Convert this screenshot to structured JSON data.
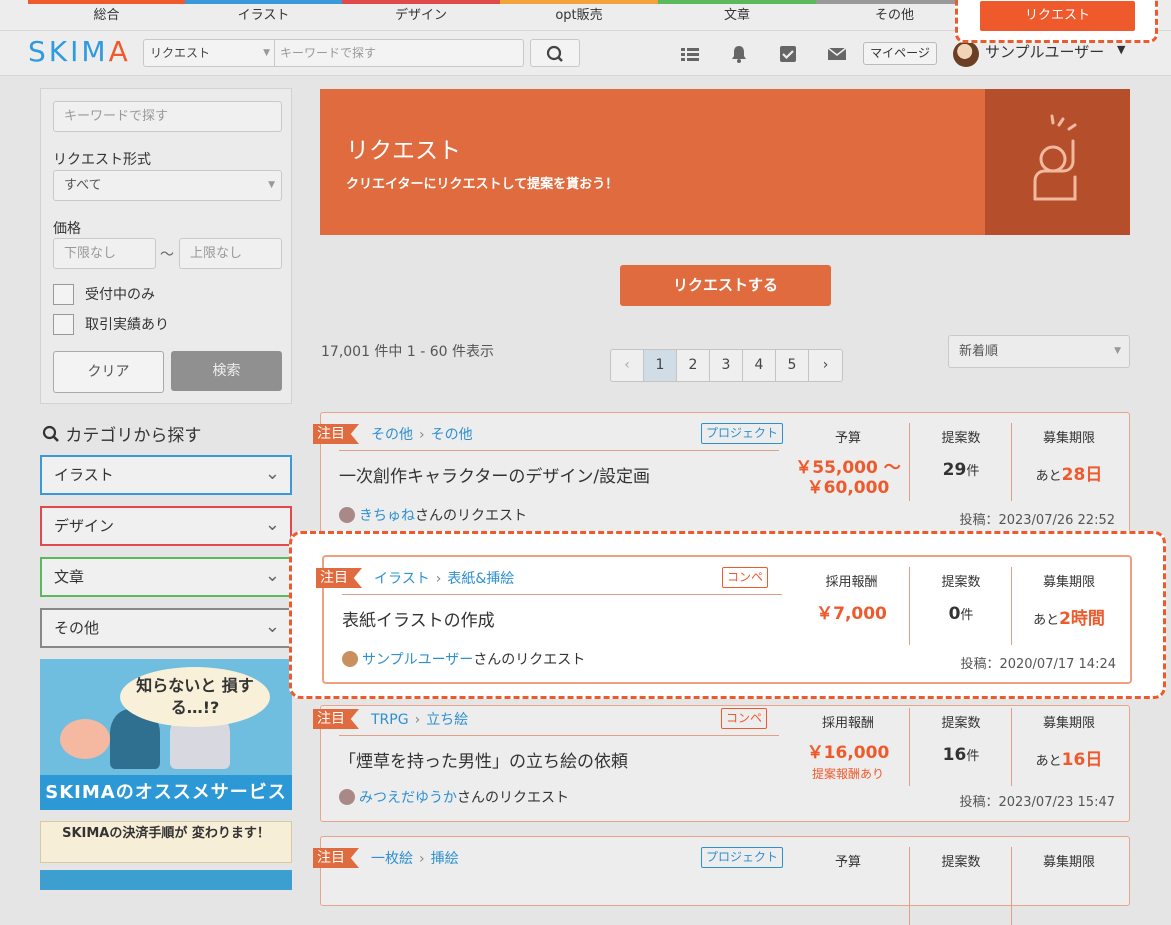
{
  "catbar": [
    {
      "label": "総合",
      "color": "#ee5a2c"
    },
    {
      "label": "イラスト",
      "color": "#3a9ad9"
    },
    {
      "label": "デザイン",
      "color": "#e04a4a"
    },
    {
      "label": "opt販売",
      "color": "#f2a33a"
    },
    {
      "label": "文章",
      "color": "#5cb85c"
    },
    {
      "label": "その他",
      "color": "#999999"
    }
  ],
  "header": {
    "logo_main": "SKIM",
    "logo_accent": "A",
    "search_type": "リクエスト",
    "search_placeholder": "キーワードで探す",
    "mypage": "マイページ",
    "username": "サンプルユーザー",
    "request_button": "リクエスト"
  },
  "sidebar": {
    "keyword_placeholder": "キーワードで探す",
    "format_label": "リクエスト形式",
    "format_value": "すべて",
    "price_label": "価格",
    "price_min": "下限なし",
    "price_sep": "〜",
    "price_max": "上限なし",
    "open_only": "受付中のみ",
    "has_history": "取引実績あり",
    "clear": "クリア",
    "search": "検索",
    "category_heading": "カテゴリから探す",
    "categories": [
      {
        "label": "イラスト",
        "color": "#3a9ad9"
      },
      {
        "label": "デザイン",
        "color": "#e04a4a"
      },
      {
        "label": "文章",
        "color": "#5cb85c"
      },
      {
        "label": "その他",
        "color": "#888888"
      }
    ],
    "banner1_bubble": "知らないと 損する…!?",
    "banner1_title": "SKIMAのオススメサービス",
    "banner2_text": "SKIMAの決済手順が 変わります！"
  },
  "main": {
    "hero_title": "リクエスト",
    "hero_sub": "クリエイターにリクエストして提案を貰おう！",
    "request_button": "リクエストする",
    "count": "17,001 件中 1 - 60 件表示",
    "pager": [
      "‹",
      "1",
      "2",
      "3",
      "4",
      "5",
      "›"
    ],
    "sort": "新着順",
    "cards": [
      {
        "flag": "注目",
        "cat1": "その他",
        "cat2": "その他",
        "tag": "プロジェクト",
        "tag_type": "blue",
        "title": "一次創作キャラクターのデザイン/設定画",
        "user": "きちゅね",
        "user_suffix": "さんのリクエスト",
        "date": "投稿：2023/07/26 22:52",
        "col1_h": "予算",
        "col1_v": "￥55,000 〜 ￥60,000",
        "col1_sub": "",
        "col2_h": "提案数",
        "col2_n": "29",
        "col2_u": "件",
        "col3_h": "募集期限",
        "col3_pre": "あと",
        "col3_v": "28日"
      },
      {
        "flag": "注目",
        "cat1": "イラスト",
        "cat2": "表紙&挿絵",
        "tag": "コンペ",
        "tag_type": "org",
        "title": "表紙イラストの作成",
        "user": "サンプルユーザー",
        "user_suffix": "さんのリクエスト",
        "date": "投稿：2020/07/17 14:24",
        "col1_h": "採用報酬",
        "col1_v": "￥7,000",
        "col1_sub": "",
        "col2_h": "提案数",
        "col2_n": "0",
        "col2_u": "件",
        "col3_h": "募集期限",
        "col3_pre": "あと",
        "col3_v": "2時間"
      },
      {
        "flag": "注目",
        "cat1": "TRPG",
        "cat2": "立ち絵",
        "tag": "コンペ",
        "tag_type": "org",
        "title": "「煙草を持った男性」の立ち絵の依頼",
        "user": "みつえだゆうか",
        "user_suffix": "さんのリクエスト",
        "date": "投稿：2023/07/23 15:47",
        "col1_h": "採用報酬",
        "col1_v": "￥16,000",
        "col1_sub": "提案報酬あり",
        "col2_h": "提案数",
        "col2_n": "16",
        "col2_u": "件",
        "col3_h": "募集期限",
        "col3_pre": "あと",
        "col3_v": "16日"
      },
      {
        "flag": "注目",
        "cat1": "一枚絵",
        "cat2": "挿絵",
        "tag": "プロジェクト",
        "tag_type": "blue",
        "title": "",
        "user": "",
        "user_suffix": "",
        "date": "",
        "col1_h": "予算",
        "col1_v": "",
        "col1_sub": "",
        "col2_h": "提案数",
        "col2_n": "",
        "col2_u": "",
        "col3_h": "募集期限",
        "col3_pre": "",
        "col3_v": ""
      }
    ]
  }
}
